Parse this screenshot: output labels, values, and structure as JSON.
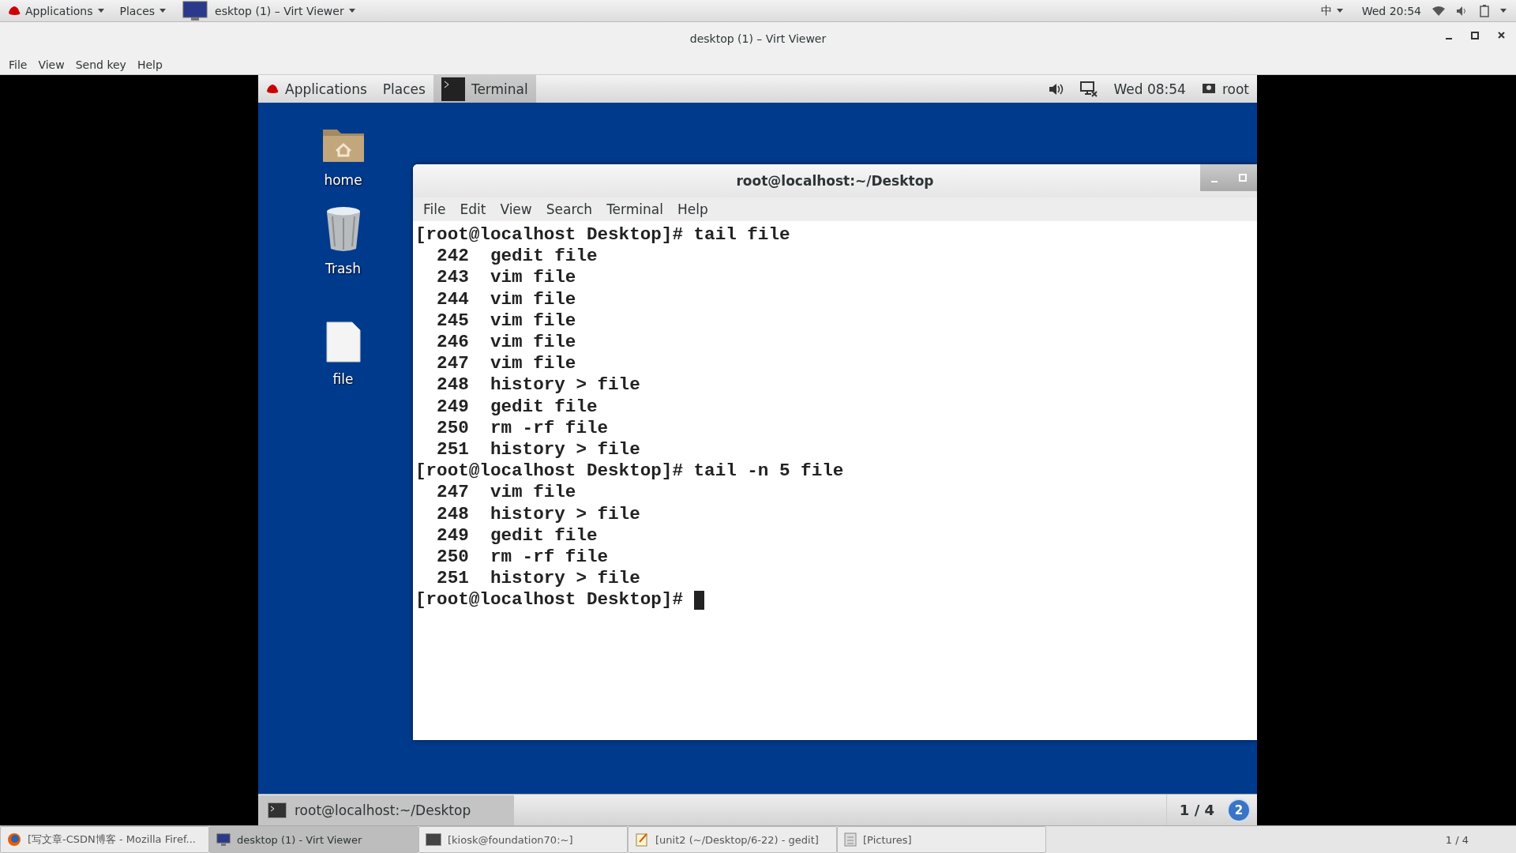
{
  "host_top_bar": {
    "apps_menu": "Applications",
    "places_menu": "Places",
    "window_menu": "esktop (1) – Virt Viewer",
    "input_method": "中",
    "clock": "Wed 20:54"
  },
  "viewer_window": {
    "title": "desktop (1) – Virt Viewer",
    "menu": [
      "File",
      "View",
      "Send key",
      "Help"
    ]
  },
  "guest": {
    "top_bar": {
      "apps_menu": "Applications",
      "places_menu": "Places",
      "active_app": "Terminal",
      "clock": "Wed 08:54",
      "user": "root"
    },
    "desktop_icons": [
      {
        "label": "home",
        "kind": "folder"
      },
      {
        "label": "Trash",
        "kind": "trash"
      },
      {
        "label": "file",
        "kind": "file"
      }
    ],
    "terminal": {
      "title": "root@localhost:~/Desktop",
      "menu": [
        "File",
        "Edit",
        "View",
        "Search",
        "Terminal",
        "Help"
      ],
      "lines": [
        "[root@localhost Desktop]# tail file",
        "  242  gedit file",
        "  243  vim file",
        "  244  vim file",
        "  245  vim file",
        "  246  vim file",
        "  247  vim file",
        "  248  history > file",
        "  249  gedit file",
        "  250  rm -rf file",
        "  251  history > file",
        "[root@localhost Desktop]# tail -n 5 file",
        "  247  vim file",
        "  248  history > file",
        "  249  gedit file",
        "  250  rm -rf file",
        "  251  history > file",
        "[root@localhost Desktop]# "
      ]
    },
    "bottom_panel": {
      "task": "root@localhost:~/Desktop",
      "workspace": "1 / 4",
      "notifications": "2"
    }
  },
  "host_taskbar": {
    "items": [
      {
        "label": "[写文章-CSDN博客 - Mozilla Firef...",
        "kind": "browser",
        "selected": false
      },
      {
        "label": "desktop (1) - Virt Viewer",
        "kind": "monitor",
        "selected": true
      },
      {
        "label": "[kiosk@foundation70:~]",
        "kind": "terminal",
        "selected": false
      },
      {
        "label": "[unit2 (~/Desktop/6-22) - gedit]",
        "kind": "editor",
        "selected": false
      },
      {
        "label": "[Pictures]",
        "kind": "images",
        "selected": false
      }
    ],
    "workspace": "1 / 4"
  }
}
